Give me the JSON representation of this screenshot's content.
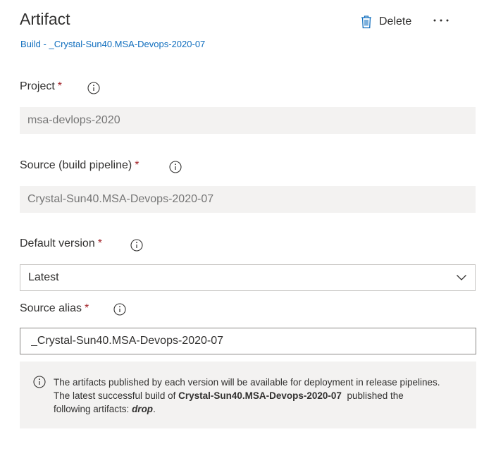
{
  "header": {
    "title": "Artifact",
    "subtitle": "Build - _Crystal-Sun40.MSA-Devops-2020-07",
    "delete_label": "Delete",
    "more_label": "···"
  },
  "fields": {
    "project": {
      "label": "Project",
      "required_mark": "*",
      "value": "msa-devlops-2020"
    },
    "source": {
      "label": "Source (build pipeline)",
      "required_mark": "*",
      "value": "Crystal-Sun40.MSA-Devops-2020-07"
    },
    "default_version": {
      "label": "Default version",
      "required_mark": "*",
      "value": "Latest"
    },
    "source_alias": {
      "label": "Source alias",
      "required_mark": "*",
      "value": "_Crystal-Sun40.MSA-Devops-2020-07"
    }
  },
  "info_note": {
    "line1": "The artifacts published by each version will be available for deployment in release pipelines.",
    "line2_prefix": "The latest successful build of",
    "line2_build": "Crystal-Sun40.MSA-Devops-2020-07",
    "line2_suffix": "published the",
    "line3_prefix": "following artifacts:",
    "line3_artifact": "drop",
    "line3_suffix": "."
  },
  "icons": {
    "delete": "trash-icon",
    "more": "more-icon",
    "info": "info-icon",
    "dropdown": "chevron-down-icon"
  },
  "colors": {
    "link": "#106ebe",
    "required": "#a4262c",
    "disabled_bg": "#f3f2f1",
    "text": "#323130"
  }
}
